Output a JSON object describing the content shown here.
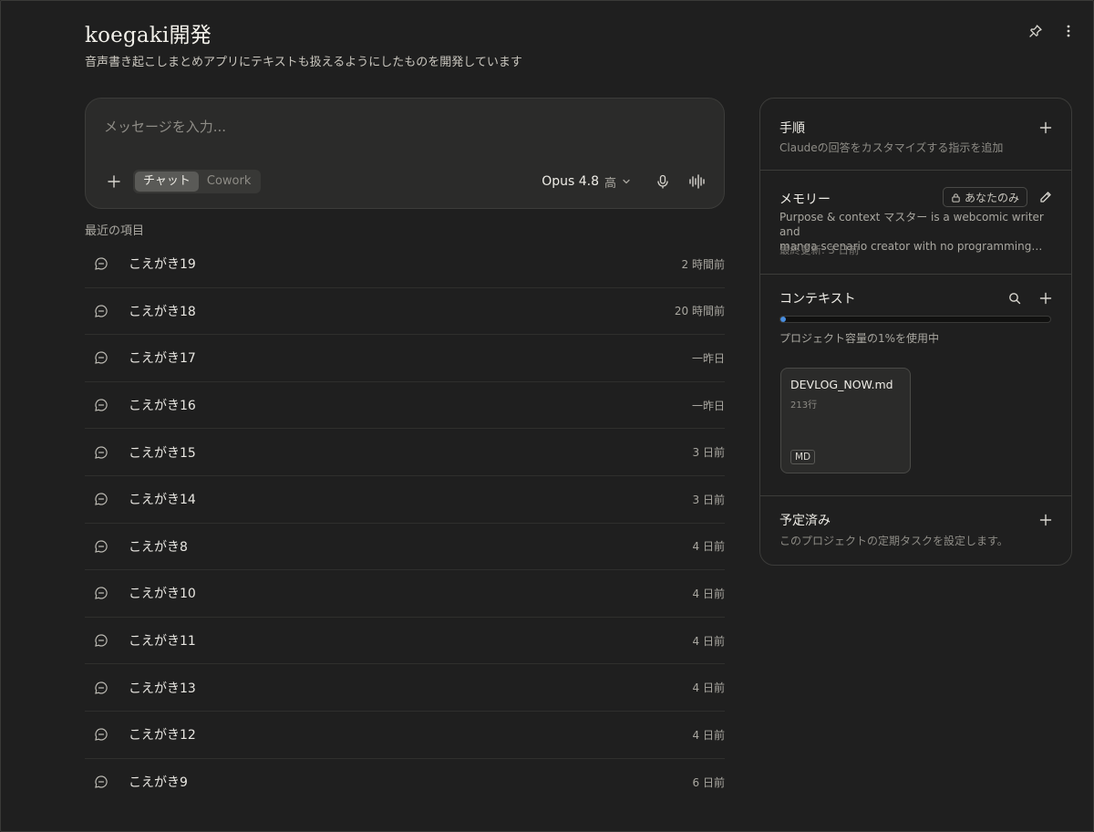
{
  "project": {
    "title": "koegaki開発",
    "description": "音声書き起こしまとめアプリにテキストも扱えるようにしたものを開発しています"
  },
  "top_actions": {
    "pin_icon": "pin-icon",
    "more_icon": "more-vertical-icon"
  },
  "composer": {
    "placeholder": "メッセージを入力...",
    "modes": [
      "チャット",
      "Cowork"
    ],
    "active_mode": "チャット",
    "model": "Opus 4.8",
    "effort": "高"
  },
  "recents": {
    "heading": "最近の項目",
    "items": [
      {
        "name": "こえがき19",
        "time": "2 時間前"
      },
      {
        "name": "こえがき18",
        "time": "20 時間前"
      },
      {
        "name": "こえがき17",
        "time": "一昨日"
      },
      {
        "name": "こえがき16",
        "time": "一昨日"
      },
      {
        "name": "こえがき15",
        "time": "3 日前"
      },
      {
        "name": "こえがき14",
        "time": "3 日前"
      },
      {
        "name": "こえがき8",
        "time": "4 日前"
      },
      {
        "name": "こえがき10",
        "time": "4 日前"
      },
      {
        "name": "こえがき11",
        "time": "4 日前"
      },
      {
        "name": "こえがき13",
        "time": "4 日前"
      },
      {
        "name": "こえがき12",
        "time": "4 日前"
      },
      {
        "name": "こえがき9",
        "time": "6 日前"
      }
    ]
  },
  "side": {
    "instructions": {
      "title": "手順",
      "desc": "Claudeの回答をカスタマイズする指示を追加"
    },
    "memory": {
      "title": "メモリー",
      "badge": "あなたのみ",
      "text_line1": "Purpose & context マスター is a webcomic writer and",
      "text_line2": "manga scenario creator with no programming…",
      "updated": "最終更新: 3 日前"
    },
    "context": {
      "title": "コンテキスト",
      "usage_percent": 1,
      "usage_text": "プロジェクト容量の1%を使用中",
      "files": [
        {
          "name": "DEVLOG_NOW.md",
          "lines": "213行",
          "type": "MD"
        }
      ]
    },
    "scheduled": {
      "title": "予定済み",
      "desc": "このプロジェクトの定期タスクを設定します。"
    }
  },
  "colors": {
    "accent": "#4a8fe0",
    "background": "#1f1f1f",
    "surface": "#2b2b2a"
  }
}
